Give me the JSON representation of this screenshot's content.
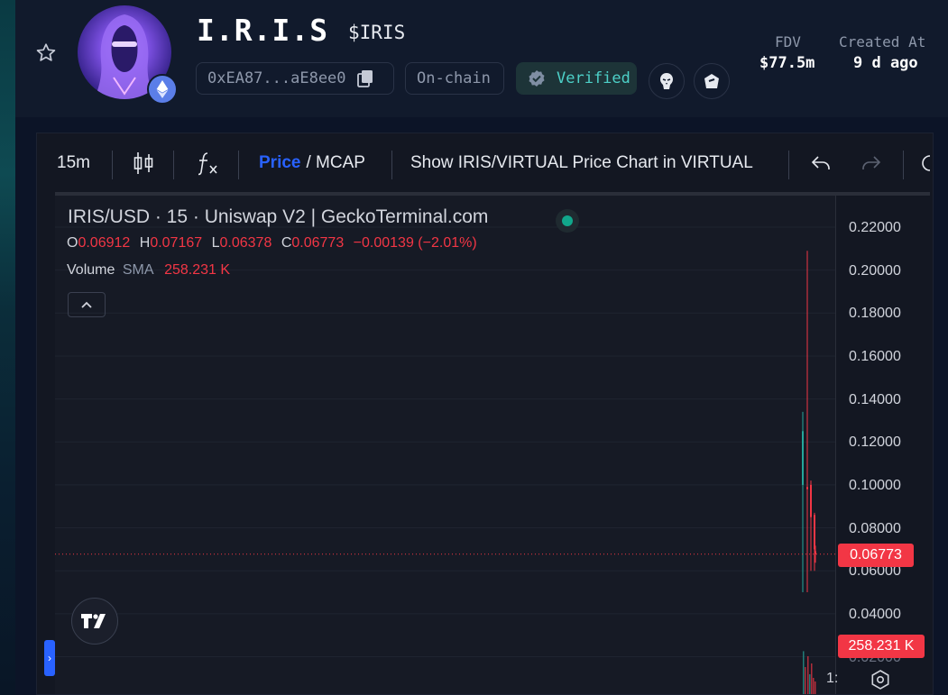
{
  "token": {
    "name": "I.R.I.S",
    "symbol": "$IRIS",
    "address": "0xEA87...aE8ee0",
    "chain_label": "On-chain",
    "verified_label": "Verified",
    "stats": [
      {
        "label": "FDV",
        "value": "$77.5m"
      },
      {
        "label": "Created At",
        "value": "9 d ago"
      }
    ]
  },
  "toolbar": {
    "interval": "15m",
    "price_label": "Price",
    "mcap_label": "/ MCAP",
    "show_chart_label": "Show IRIS/VIRTUAL Price Chart in VIRTUAL"
  },
  "legend": {
    "title": "IRIS/USD · 15 · Uniswap V2 | GeckoTerminal.com",
    "o_label": "O",
    "o_value": "0.06912",
    "h_label": "H",
    "h_value": "0.07167",
    "l_label": "L",
    "l_value": "0.06378",
    "c_label": "C",
    "c_value": "0.06773",
    "change": "−0.00139 (−2.01%)",
    "volume_label": "Volume",
    "sma_label": "SMA",
    "volume_value": "258.231 K"
  },
  "axis_ticks": [
    "0.22000",
    "0.20000",
    "0.18000",
    "0.16000",
    "0.14000",
    "0.12000",
    "0.10000",
    "0.08000",
    "0.06000",
    "0.04000",
    "0.02000"
  ],
  "current_price_tag": "0.06773",
  "current_volume_tag": "258.231 K",
  "time_axis_partial": "1:",
  "colors": {
    "up": "#26a69a",
    "down": "#f23645",
    "accent": "#2962ff",
    "verified": "#4dd0c8"
  },
  "chart_data": {
    "type": "candlestick",
    "pair": "IRIS/USD",
    "interval": "15",
    "ylim": [
      0.02,
      0.22
    ],
    "candles": [
      {
        "o": 0.1,
        "h": 0.134,
        "l": 0.05,
        "c": 0.125,
        "dir": "up"
      },
      {
        "o": 0.099,
        "h": 0.209,
        "l": 0.05,
        "c": 0.098,
        "dir": "down"
      },
      {
        "o": 0.1,
        "h": 0.102,
        "l": 0.06,
        "c": 0.085,
        "dir": "down"
      },
      {
        "o": 0.086,
        "h": 0.087,
        "l": 0.06,
        "c": 0.07,
        "dir": "down"
      },
      {
        "o": 0.06912,
        "h": 0.07167,
        "l": 0.06378,
        "c": 0.06773,
        "dir": "down"
      }
    ]
  }
}
